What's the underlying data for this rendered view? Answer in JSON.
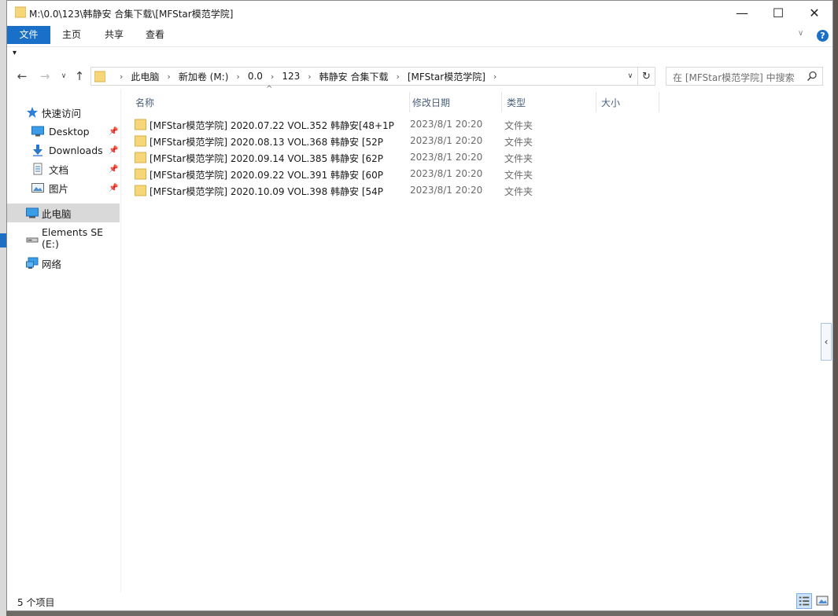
{
  "window": {
    "title": "M:\\0.0\\123\\韩静安 合集下载\\[MFStar模范学院]"
  },
  "ribbon": {
    "tabs": {
      "file": "文件",
      "home": "主页",
      "share": "共享",
      "view": "查看"
    },
    "help": "?"
  },
  "nav": {
    "breadcrumbs": [
      "此电脑",
      "新加卷 (M:)",
      "0.0",
      "123",
      "韩静安 合集下载",
      "[MFStar模范学院]"
    ],
    "search_placeholder": "在 [MFStar模范学院] 中搜索"
  },
  "sidebar": {
    "quick_access": "快速访问",
    "items": [
      {
        "label": "Desktop",
        "icon": "desktop-icon",
        "pinned": true
      },
      {
        "label": "Downloads",
        "icon": "downloads-icon",
        "pinned": true
      },
      {
        "label": "文档",
        "icon": "documents-icon",
        "pinned": true
      },
      {
        "label": "图片",
        "icon": "pictures-icon",
        "pinned": true
      }
    ],
    "this_pc": "此电脑",
    "drive": "Elements SE (E:)",
    "network": "网络"
  },
  "columns": {
    "name": "名称",
    "modified": "修改日期",
    "type": "类型",
    "size": "大小"
  },
  "files": [
    {
      "name": "[MFStar模范学院] 2020.07.22 VOL.352 韩静安[48+1P",
      "modified": "2023/8/1 20:20",
      "type": "文件夹"
    },
    {
      "name": "[MFStar模范学院] 2020.08.13 VOL.368 韩静安 [52P",
      "modified": "2023/8/1 20:20",
      "type": "文件夹"
    },
    {
      "name": "[MFStar模范学院] 2020.09.14 VOL.385 韩静安 [62P",
      "modified": "2023/8/1 20:20",
      "type": "文件夹"
    },
    {
      "name": "[MFStar模范学院] 2020.09.22 VOL.391 韩静安 [60P",
      "modified": "2023/8/1 20:20",
      "type": "文件夹"
    },
    {
      "name": "[MFStar模范学院] 2020.10.09 VOL.398 韩静安 [54P",
      "modified": "2023/8/1 20:20",
      "type": "文件夹"
    }
  ],
  "status": {
    "item_count": "5 个项目"
  },
  "colors": {
    "accent": "#1a6fc9",
    "folder": "#f7d67a",
    "selected_bg": "#d9d9d9"
  }
}
